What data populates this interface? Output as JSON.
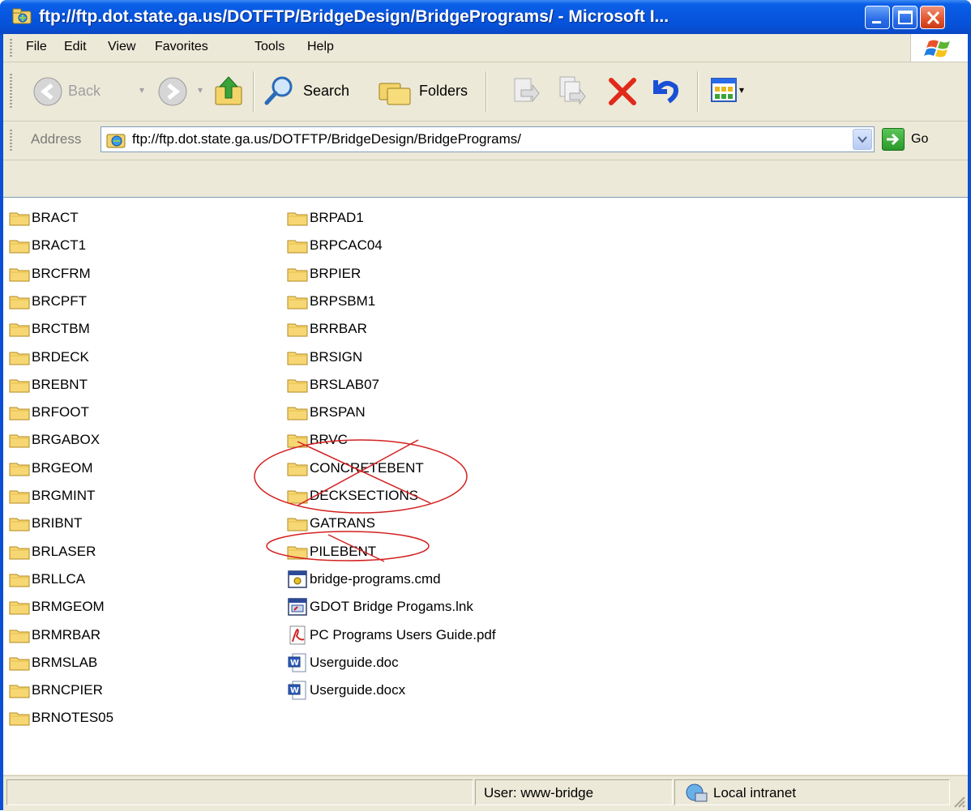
{
  "window": {
    "title": "ftp://ftp.dot.state.ga.us/DOTFTP/BridgeDesign/BridgePrograms/ - Microsoft I..."
  },
  "menu": [
    "File",
    "Edit",
    "View",
    "Favorites",
    "Tools",
    "Help"
  ],
  "toolbar": {
    "back_label": "Back",
    "search_label": "Search",
    "folders_label": "Folders"
  },
  "address": {
    "label": "Address",
    "url": "ftp://ftp.dot.state.ga.us/DOTFTP/BridgeDesign/BridgePrograms/",
    "go_label": "Go"
  },
  "files": {
    "column1": [
      "BRACT",
      "BRACT1",
      "BRCFRM",
      "BRCPFT",
      "BRCTBM",
      "BRDECK",
      "BREBNT",
      "BRFOOT",
      "BRGABOX",
      "BRGEOM",
      "BRGMINT",
      "BRIBNT",
      "BRLASER",
      "BRLLCA",
      "BRMGEOM",
      "BRMRBAR",
      "BRMSLAB",
      "BRNCPIER",
      "BRNOTES05"
    ],
    "column2": [
      {
        "name": "BRPAD1",
        "type": "folder"
      },
      {
        "name": "BRPCAC04",
        "type": "folder"
      },
      {
        "name": "BRPIER",
        "type": "folder"
      },
      {
        "name": "BRPSBM1",
        "type": "folder"
      },
      {
        "name": "BRRBAR",
        "type": "folder"
      },
      {
        "name": "BRSIGN",
        "type": "folder"
      },
      {
        "name": "BRSLAB07",
        "type": "folder"
      },
      {
        "name": "BRSPAN",
        "type": "folder"
      },
      {
        "name": "BRVC",
        "type": "folder"
      },
      {
        "name": "CONCRETEBENT",
        "type": "folder"
      },
      {
        "name": "DECKSECTIONS",
        "type": "folder"
      },
      {
        "name": "GATRANS",
        "type": "folder"
      },
      {
        "name": "PILEBENT",
        "type": "folder"
      },
      {
        "name": "bridge-programs.cmd",
        "type": "cmd"
      },
      {
        "name": "GDOT Bridge Progams.lnk",
        "type": "lnk"
      },
      {
        "name": "PC Programs Users Guide.pdf",
        "type": "pdf"
      },
      {
        "name": "Userguide.doc",
        "type": "doc"
      },
      {
        "name": "Userguide.docx",
        "type": "doc"
      }
    ]
  },
  "status": {
    "user": "User: www-bridge",
    "zone": "Local intranet"
  },
  "colors": {
    "annotation": "#d42020",
    "titlebar": "#0a5fe8",
    "folder": "#f7d774"
  }
}
